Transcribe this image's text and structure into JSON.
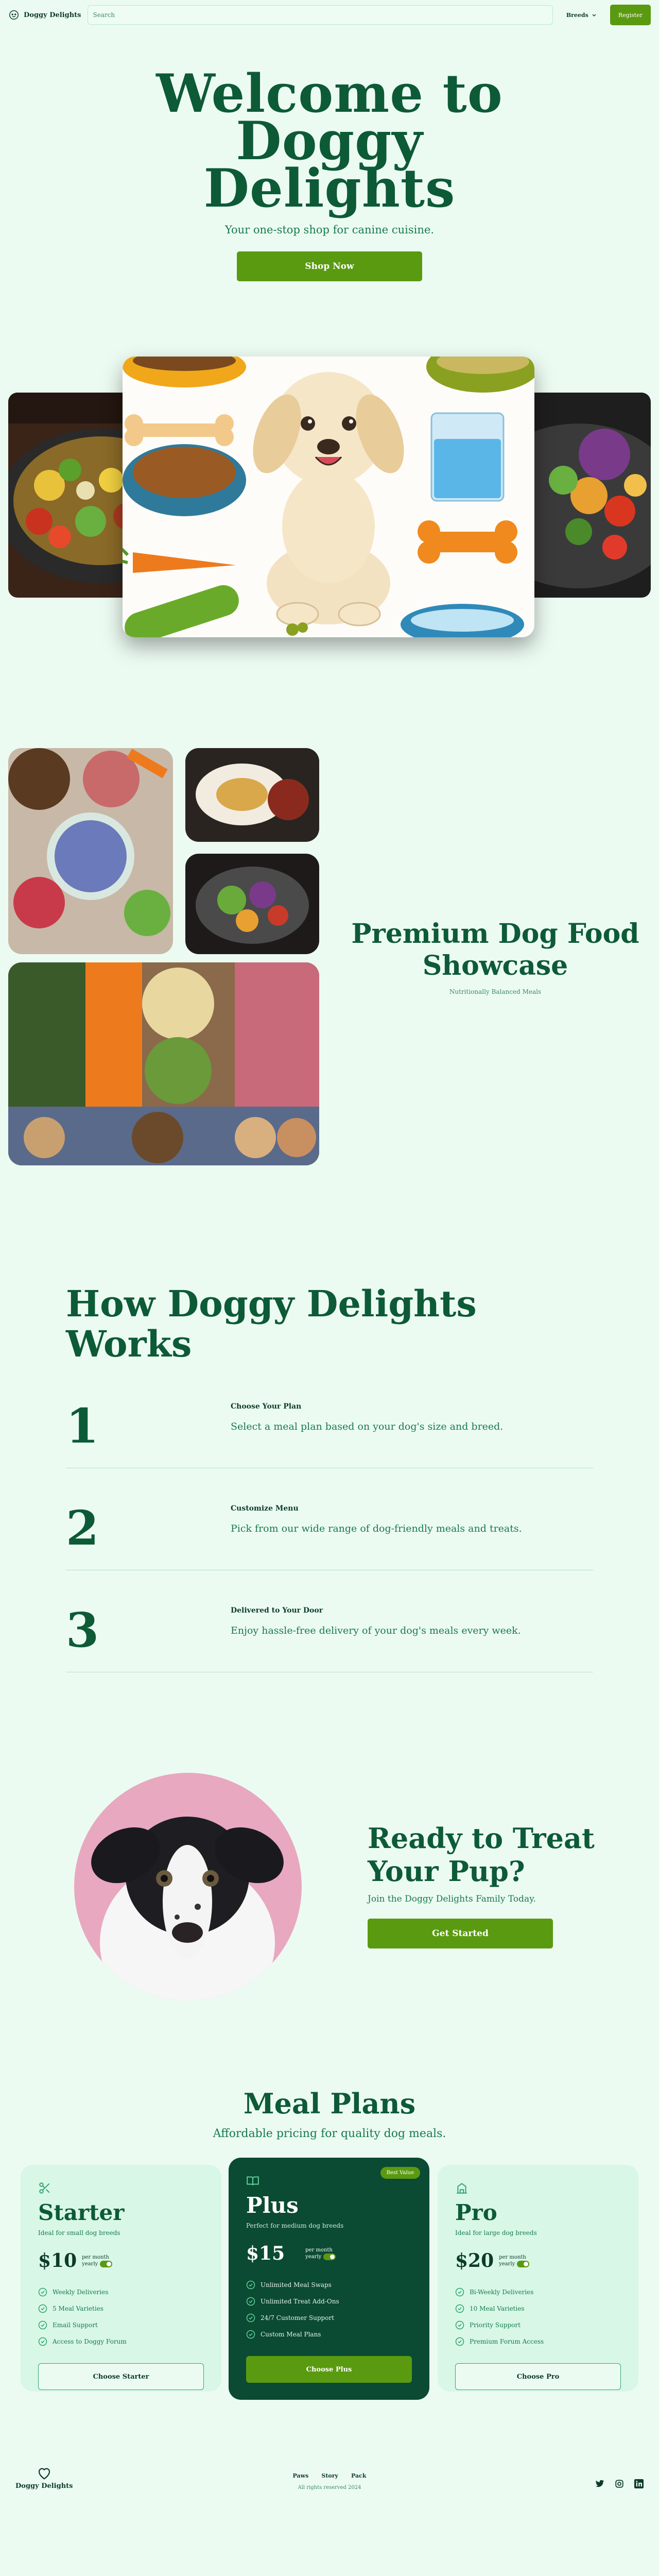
{
  "nav": {
    "brand": "Doggy Delights",
    "search_placeholder": "Search",
    "breeds_label": "Breeds",
    "register_label": "Register"
  },
  "hero": {
    "title": "Welcome to Doggy Delights",
    "tagline": "Your one-stop shop for canine cuisine.",
    "cta": "Shop Now"
  },
  "showcase": {
    "title": "Premium Dog Food Showcase",
    "subtitle": "Nutritionally Balanced Meals"
  },
  "how": {
    "title": "How Doggy Delights Works",
    "steps": [
      {
        "num": "1",
        "title": "Choose Your Plan",
        "desc": "Select a meal plan based on your dog's size and breed."
      },
      {
        "num": "2",
        "title": "Customize Menu",
        "desc": "Pick from our wide range of dog-friendly meals and treats."
      },
      {
        "num": "3",
        "title": "Delivered to Your Door",
        "desc": "Enjoy hassle-free delivery of your dog's meals every week."
      }
    ]
  },
  "cta": {
    "title": "Ready to Treat Your Pup?",
    "subtitle": "Join the Doggy Delights Family Today.",
    "button": "Get Started"
  },
  "pricing": {
    "title": "Meal Plans",
    "subtitle": "Affordable pricing for quality dog meals.",
    "plans": [
      {
        "name": "Starter",
        "ideal": "Ideal for small dog breeds",
        "price": "$10",
        "per": "per month",
        "yearly": "yearly",
        "features": [
          "Weekly Deliveries",
          "5 Meal Varieties",
          "Email Support",
          "Access to Doggy Forum"
        ],
        "button": "Choose Starter"
      },
      {
        "name": "Plus",
        "ideal": "Perfect for medium dog breeds",
        "price": "$15",
        "per": "per month",
        "yearly": "yearly",
        "badge": "Best Value",
        "features": [
          "Unlimited Meal Swaps",
          "Unlimited Treat Add-Ons",
          "24/7 Customer Support",
          "Custom Meal Plans"
        ],
        "button": "Choose Plus"
      },
      {
        "name": "Pro",
        "ideal": "Ideal for large dog breeds",
        "price": "$20",
        "per": "per month",
        "yearly": "yearly",
        "features": [
          "Bi-Weekly Deliveries",
          "10 Meal Varieties",
          "Priority Support",
          "Premium Forum Access"
        ],
        "button": "Choose Pro"
      }
    ]
  },
  "footer": {
    "brand": "Doggy Delights",
    "links": [
      "Paws",
      "Story",
      "Pack"
    ],
    "copyright": "All rights reserved 2024"
  },
  "icons": [
    "dog-logo-icon",
    "chevron-down-icon",
    "scissors-icon",
    "book-icon",
    "building-icon",
    "check-circle-icon",
    "heart-icon",
    "twitter-icon",
    "instagram-icon",
    "linkedin-icon"
  ],
  "colors": {
    "accent": "#5a9a10",
    "brand_dark": "#0d5a37",
    "background": "#ecfbf2",
    "featured_card": "#0b4a33"
  }
}
